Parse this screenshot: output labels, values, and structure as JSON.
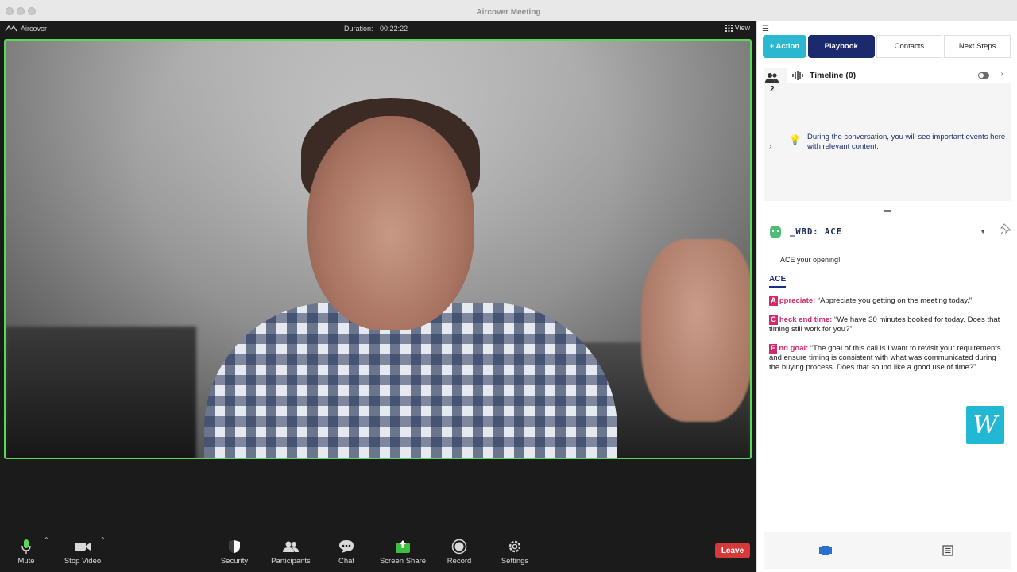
{
  "window": {
    "title": "Aircover Meeting"
  },
  "meeting": {
    "brand": "Aircover",
    "duration_label": "Duration:",
    "duration_value": "00:22:22",
    "view_label": "View"
  },
  "toolbar": {
    "mute": "Mute",
    "stop_video": "Stop Video",
    "security": "Security",
    "participants": "Participants",
    "chat": "Chat",
    "screen_share": "Screen Share",
    "record": "Record",
    "settings": "Settings",
    "leave": "Leave"
  },
  "panel": {
    "tabs": [
      {
        "label": "+ Action"
      },
      {
        "label": "Playbook"
      },
      {
        "label": "Contacts"
      },
      {
        "label": "Next Steps"
      }
    ],
    "participants_count": "2",
    "timeline": {
      "title": "Timeline (0)",
      "hint": "During the conversation, you will see important events here with relevant content."
    },
    "playbook": {
      "name": "_WBD: ACE",
      "intro": "ACE your opening!",
      "section": "ACE",
      "items": [
        {
          "letter": "A",
          "key": "ppreciate:",
          "text": " “Appreciate you getting on the meeting today.”"
        },
        {
          "letter": "C",
          "key": "heck end time:",
          "text": " “We have 30 minutes booked for today. Does that timing still work for you?”"
        },
        {
          "letter": "E",
          "key": "nd goal:",
          "text": " “The goal of this call is I want to revisit your requirements and ensure timing is consistent with what was communicated during the buying process. Does that sound like a good use of time?”"
        }
      ]
    }
  },
  "colors": {
    "accent_teal": "#2bb7cf",
    "tab_active": "#1a2a6c",
    "highlight_pink": "#d6286d",
    "leave_red": "#d43a3a",
    "video_border": "#5bd85b"
  },
  "icons": {
    "mute": "microphone-icon",
    "stop_video": "video-camera-icon",
    "security": "shield-icon",
    "participants": "participants-icon",
    "chat": "chat-bubble-icon",
    "screen_share": "screen-share-icon",
    "record": "record-icon",
    "settings": "gear-icon"
  }
}
